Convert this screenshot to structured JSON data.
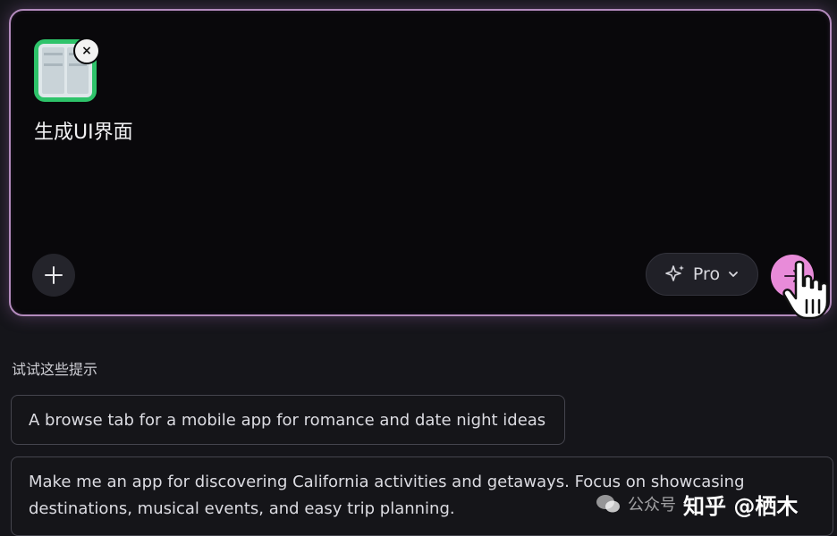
{
  "prompt": {
    "text": "生成UI界面",
    "attachment_remove_label": "×"
  },
  "toolbar": {
    "model_label": "Pro"
  },
  "suggestions": {
    "heading": "试试这些提示",
    "items": [
      "A browse tab for a mobile app for romance and date night ideas",
      "Make me an app for discovering California activities and getaways. Focus on showcasing destinations, musical events, and easy trip planning."
    ]
  },
  "watermark": {
    "wechat_text": "公众号",
    "site_text": "知乎 @栖木"
  },
  "colors": {
    "send_button": "#e88bd9",
    "card_border": "#b38bbd",
    "attachment_frame": "#2ec36a"
  }
}
